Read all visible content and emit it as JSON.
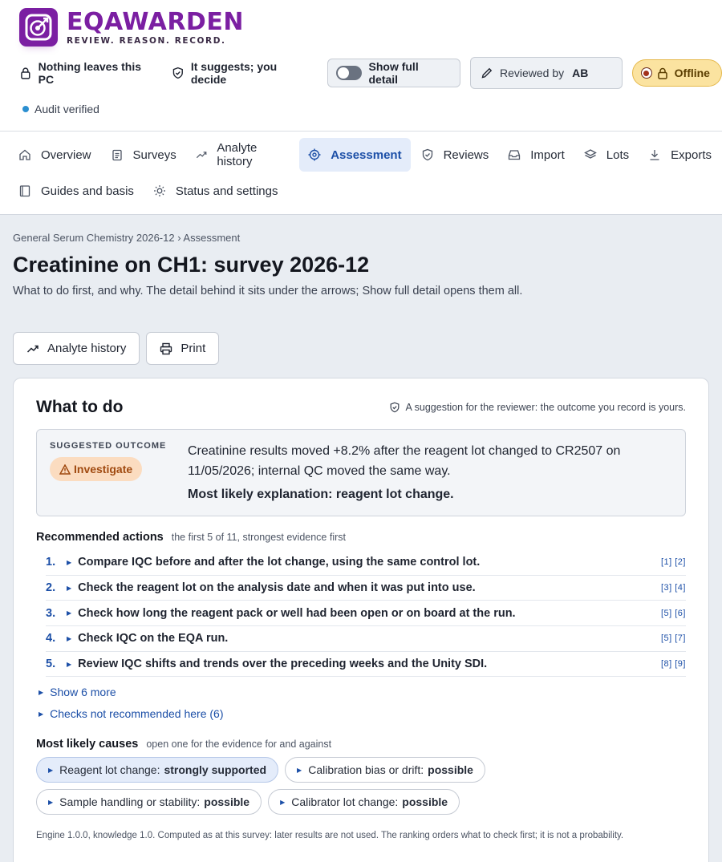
{
  "app": {
    "brand": "EQAWARDEN",
    "tagline": "REVIEW. REASON. RECORD."
  },
  "header": {
    "privacy_label": "Nothing leaves this PC",
    "suggest_label": "It suggests; you decide",
    "detail_toggle_label": "Show full detail",
    "detail_toggle_on": false,
    "reviewer_label": "Reviewed by",
    "reviewer_value": "AB",
    "offline_label": "Offline",
    "audit_label": "Audit verified"
  },
  "nav": {
    "items": [
      {
        "label": "Overview",
        "icon": "home-icon"
      },
      {
        "label": "Surveys",
        "icon": "clipboard-icon"
      },
      {
        "label": "Analyte history",
        "icon": "trend-icon"
      },
      {
        "label": "Assessment",
        "icon": "target-icon",
        "active": true
      },
      {
        "label": "Reviews",
        "icon": "shield-check-icon"
      },
      {
        "label": "Import",
        "icon": "inbox-icon"
      },
      {
        "label": "Lots",
        "icon": "layers-icon"
      },
      {
        "label": "Exports",
        "icon": "download-icon"
      },
      {
        "label": "Guides and basis",
        "icon": "book-icon"
      },
      {
        "label": "Status and settings",
        "icon": "sun-icon"
      }
    ]
  },
  "page": {
    "breadcrumb": "General Serum Chemistry 2026-12 › Assessment",
    "title": "Creatinine on CH1: survey 2026-12",
    "subtitle": "What to do first, and why. The detail behind it sits under the arrows; Show full detail opens them all.",
    "buttons": {
      "history": "Analyte history",
      "print": "Print"
    }
  },
  "card": {
    "title": "What to do",
    "note": "A suggestion for the reviewer: the outcome you record is yours.",
    "outcome": {
      "key": "SUGGESTED OUTCOME",
      "badge": "Investigate",
      "text": "Creatinine results moved +8.2% after the reagent lot changed to CR2507 on 11/05/2026; internal QC moved the same way.",
      "explanation": "Most likely explanation: reagent lot change."
    },
    "actions_title": "Recommended actions",
    "actions_hint": "the first 5 of 11, strongest evidence first",
    "actions": [
      {
        "n": "1.",
        "text": "Compare IQC before and after the lot change, using the same control lot.",
        "refs": "[1] [2]"
      },
      {
        "n": "2.",
        "text": "Check the reagent lot on the analysis date and when it was put into use.",
        "refs": "[3] [4]"
      },
      {
        "n": "3.",
        "text": "Check how long the reagent pack or well had been open or on board at the run.",
        "refs": "[5] [6]"
      },
      {
        "n": "4.",
        "text": "Check IQC on the EQA run.",
        "refs": "[5] [7]"
      },
      {
        "n": "5.",
        "text": "Review IQC shifts and trends over the preceding weeks and the Unity SDI.",
        "refs": "[8] [9]"
      }
    ],
    "show_more": "Show 6 more",
    "not_recommended": "Checks not recommended here (6)",
    "causes_title": "Most likely causes",
    "causes_hint": "open one for the evidence for and against",
    "causes": [
      {
        "label": "Reagent lot change:",
        "strength": "strongly supported"
      },
      {
        "label": "Calibration bias or drift:",
        "strength": "possible"
      },
      {
        "label": "Sample handling or stability:",
        "strength": "possible"
      },
      {
        "label": "Calibrator lot change:",
        "strength": "possible"
      }
    ],
    "footnote": "Engine 1.0.0, knowledge 1.0. Computed as at this survey: later results are not used. The ranking orders what to check first; it is not a probability."
  },
  "colors": {
    "brand": "#7b1fa2",
    "accent": "#1c4fa7",
    "investigate_bg": "#fbdcc0",
    "offline_bg": "#fbe3a0"
  }
}
